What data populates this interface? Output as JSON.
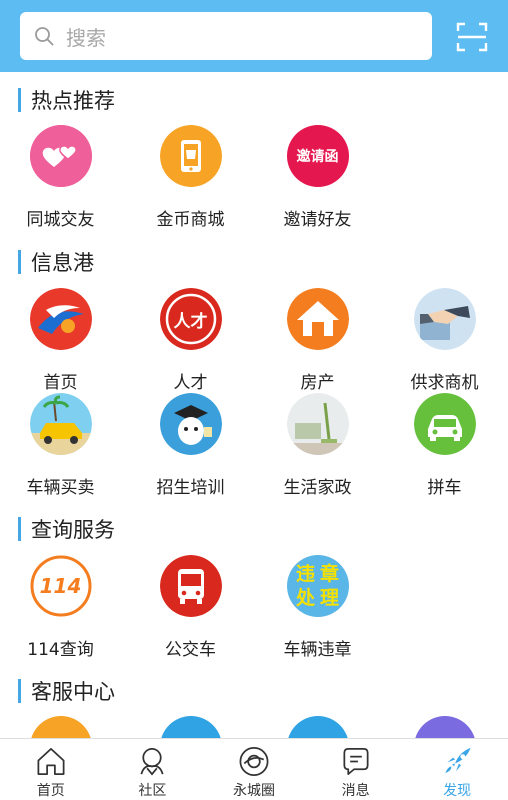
{
  "search": {
    "placeholder": "搜索"
  },
  "sections": {
    "hot": {
      "title": "热点推荐",
      "items": [
        "同城交友",
        "金币商城",
        "邀请好友"
      ],
      "badge_text": "邀请函"
    },
    "info": {
      "title": "信息港",
      "items": [
        "首页",
        "人才",
        "房产",
        "供求商机",
        "车辆买卖",
        "招生培训",
        "生活家政",
        "拼车"
      ],
      "talent_glyph": "人才"
    },
    "query": {
      "title": "查询服务",
      "items": [
        "114查询",
        "公交车",
        "车辆违章"
      ],
      "badge_114": "114",
      "violation_text": [
        "违",
        "章",
        "处",
        "理"
      ]
    },
    "service": {
      "title": "客服中心"
    }
  },
  "bottom_nav": {
    "items": [
      "首页",
      "社区",
      "永城圈",
      "消息",
      "发现"
    ],
    "active": "发现"
  },
  "colors": {
    "header": "#5dbdf2",
    "accent": "#3aa5e8",
    "section_bar": "#45a6e6"
  }
}
